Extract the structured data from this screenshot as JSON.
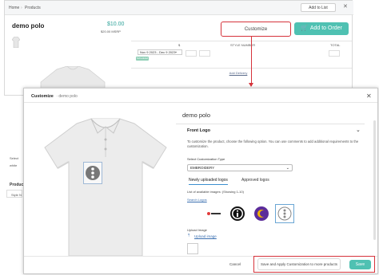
{
  "background_page": {
    "breadcrumb": [
      "Home",
      "Products"
    ],
    "add_to_list_label": "Add to List",
    "product_title": "demo polo",
    "price": "$10.00",
    "msrp": "$20.00 MSRP",
    "customize_label": "Customize",
    "add_to_order_label": "Add to Order",
    "table_headers": [
      "$",
      "STYLE NUMBER",
      "TOTAL"
    ],
    "date_range": "Nov 9 2023 - Dec 9 2023",
    "status_badge": "Scheduled",
    "add_delivery_label": "Add Delivery",
    "left_snippets": [
      "Select",
      "white",
      "Product",
      "Style N"
    ]
  },
  "modal": {
    "title": "Customize",
    "subtitle": "demo polo",
    "product_name": "demo polo",
    "section_title": "Front Logo",
    "description": "To customize the product, choose the following option. You can use comments to add additional requirements to the customization.",
    "customization_type_label": "Select Customization Type",
    "customization_type_value": "EMBROIDERY",
    "tabs": [
      "Newly uploaded logos",
      "Approved logos"
    ],
    "list_label": "List of available images: (Showing 1-10)",
    "search_logos_label": "Search Logos",
    "upload_label": "Upload Image",
    "upload_link": "Upload image",
    "cancel_label": "Cancel",
    "apply_label": "Save and Apply Customization to more products",
    "save_label": "Save"
  },
  "colors": {
    "accent": "#4fc1b2",
    "highlight": "#d6333b",
    "link": "#3a6fb0"
  },
  "icons": [
    "close-icon",
    "chevron-down-icon",
    "polo-shirt-image",
    "logo-thumbnail"
  ]
}
